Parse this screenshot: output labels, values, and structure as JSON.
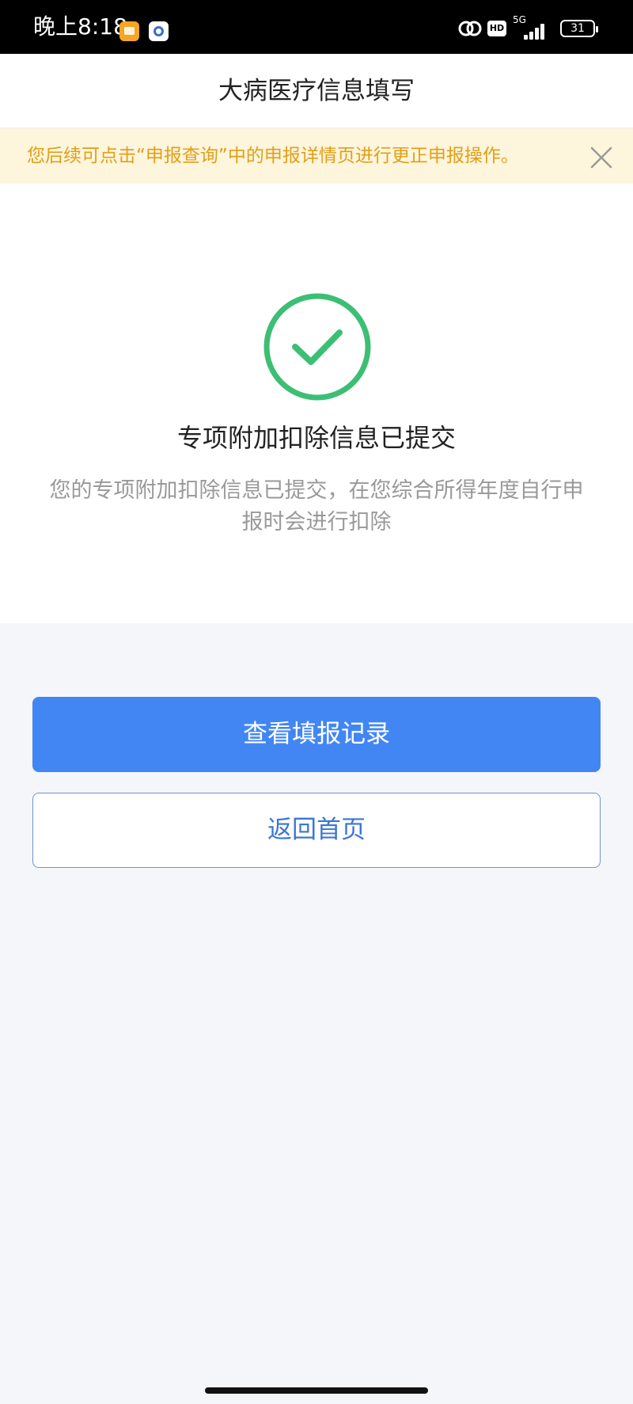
{
  "status_bar": {
    "time": "晚上8:18",
    "network": "5G",
    "hd_label": "HD",
    "battery": "31",
    "icons": [
      "message-app-icon",
      "gear-app-icon",
      "link-icon",
      "signal-icon",
      "battery-icon"
    ]
  },
  "header": {
    "title": "大病医疗信息填写"
  },
  "notice": {
    "text": "您后续可点击“申报查询”中的申报详情页进行更正申报操作。",
    "close_icon": "close-icon"
  },
  "result": {
    "icon": "check-circle-icon",
    "title": "专项附加扣除信息已提交",
    "description": "您的专项附加扣除信息已提交，在您综合所得年度自行申报时会进行扣除"
  },
  "actions": {
    "primary_label": "查看填报记录",
    "secondary_label": "返回首页"
  },
  "colors": {
    "primary": "#4286f4",
    "success": "#3cbf74",
    "notice_text": "#e0a019",
    "notice_bg": "#fdf5dc"
  }
}
